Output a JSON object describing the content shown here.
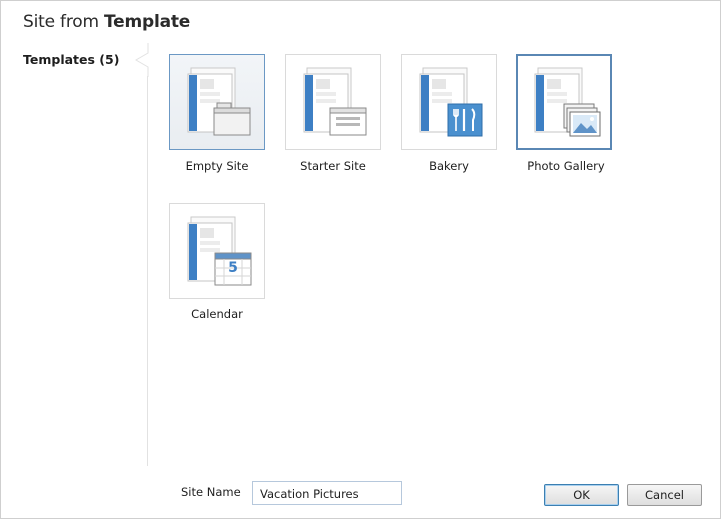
{
  "dialog": {
    "title_prefix": "Site from ",
    "title_strong": "Template"
  },
  "sidebar": {
    "items": [
      {
        "label": "Templates (5)"
      }
    ]
  },
  "templates": [
    {
      "label": "Empty Site",
      "icon": "empty-site-icon",
      "state": "hover"
    },
    {
      "label": "Starter Site",
      "icon": "starter-site-icon",
      "state": "normal"
    },
    {
      "label": "Bakery",
      "icon": "bakery-icon",
      "state": "normal"
    },
    {
      "label": "Photo Gallery",
      "icon": "photo-gallery-icon",
      "state": "selected"
    },
    {
      "label": "Calendar",
      "icon": "calendar-icon",
      "state": "normal",
      "badge": "5"
    }
  ],
  "form": {
    "site_name_label": "Site Name",
    "site_name_value": "Vacation Pictures"
  },
  "buttons": {
    "ok_label": "OK",
    "cancel_label": "Cancel"
  },
  "colors": {
    "accent": "#5a87b4",
    "page_blue": "#3d7fc4",
    "bakery_tile": "#4a90cf"
  }
}
